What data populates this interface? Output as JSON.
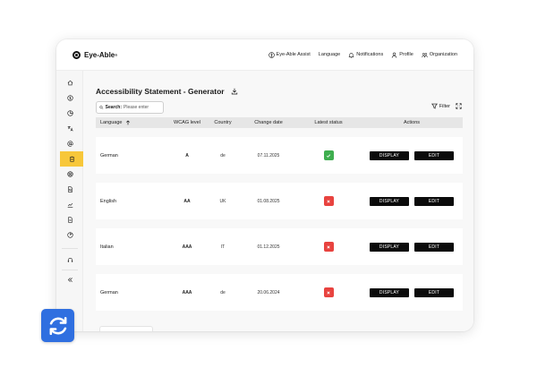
{
  "brand": {
    "name": "Eye-Able",
    "mark": "®"
  },
  "topnav": {
    "items": [
      {
        "label": "Eye-Able Assist",
        "icon": "accessibility-icon"
      },
      {
        "label": "Language",
        "icon": ""
      },
      {
        "label": "Notifications",
        "icon": "bell-icon"
      },
      {
        "label": "Profile",
        "icon": "user-icon"
      },
      {
        "label": "Organization",
        "icon": "organization-icon"
      }
    ]
  },
  "sidebar": {
    "items": [
      {
        "icon": "home-icon"
      },
      {
        "icon": "dollar-icon"
      },
      {
        "icon": "pie-chart-icon"
      },
      {
        "icon": "translate-icon"
      },
      {
        "icon": "at-sign-icon"
      },
      {
        "icon": "clipboard-icon",
        "active": true
      },
      {
        "icon": "target-icon"
      },
      {
        "icon": "document-search-icon"
      },
      {
        "icon": "trend-chart-icon"
      },
      {
        "icon": "file-icon"
      },
      {
        "icon": "report-chart-icon"
      }
    ],
    "bottom": [
      {
        "icon": "headset-icon"
      },
      {
        "icon": "collapse-icon"
      }
    ],
    "accent": "#f7c73a"
  },
  "page": {
    "title": "Accessibility Statement - Generator",
    "search_label": "Search:",
    "search_placeholder": "Please enter",
    "filter_label": "Filter"
  },
  "table": {
    "columns": {
      "language": "Language",
      "wcag": "WCAG level",
      "country": "Country",
      "date": "Change date",
      "status": "Latest status",
      "actions": "Actions"
    },
    "rows": [
      {
        "language": "German",
        "wcag": "A",
        "country": "de",
        "date": "07.11.2025",
        "status": "ok",
        "display": "DISPLAY",
        "edit": "EDIT"
      },
      {
        "language": "English",
        "wcag": "AA",
        "country": "UK",
        "date": "01.08.2025",
        "status": "fail",
        "display": "DISPLAY",
        "edit": "EDIT"
      },
      {
        "language": "Italian",
        "wcag": "AAA",
        "country": "IT",
        "date": "01.12.2025",
        "status": "fail",
        "display": "DISPLAY",
        "edit": "EDIT"
      },
      {
        "language": "German",
        "wcag": "AAA",
        "country": "de",
        "date": "20.06.2024",
        "status": "fail",
        "display": "DISPLAY",
        "edit": "EDIT"
      }
    ]
  },
  "colors": {
    "ok": "#3fae4f",
    "fail": "#e8433f",
    "sync": "#2f6fe0",
    "button": "#0b0b0b"
  },
  "overlay": {
    "icon": "sync-icon"
  }
}
